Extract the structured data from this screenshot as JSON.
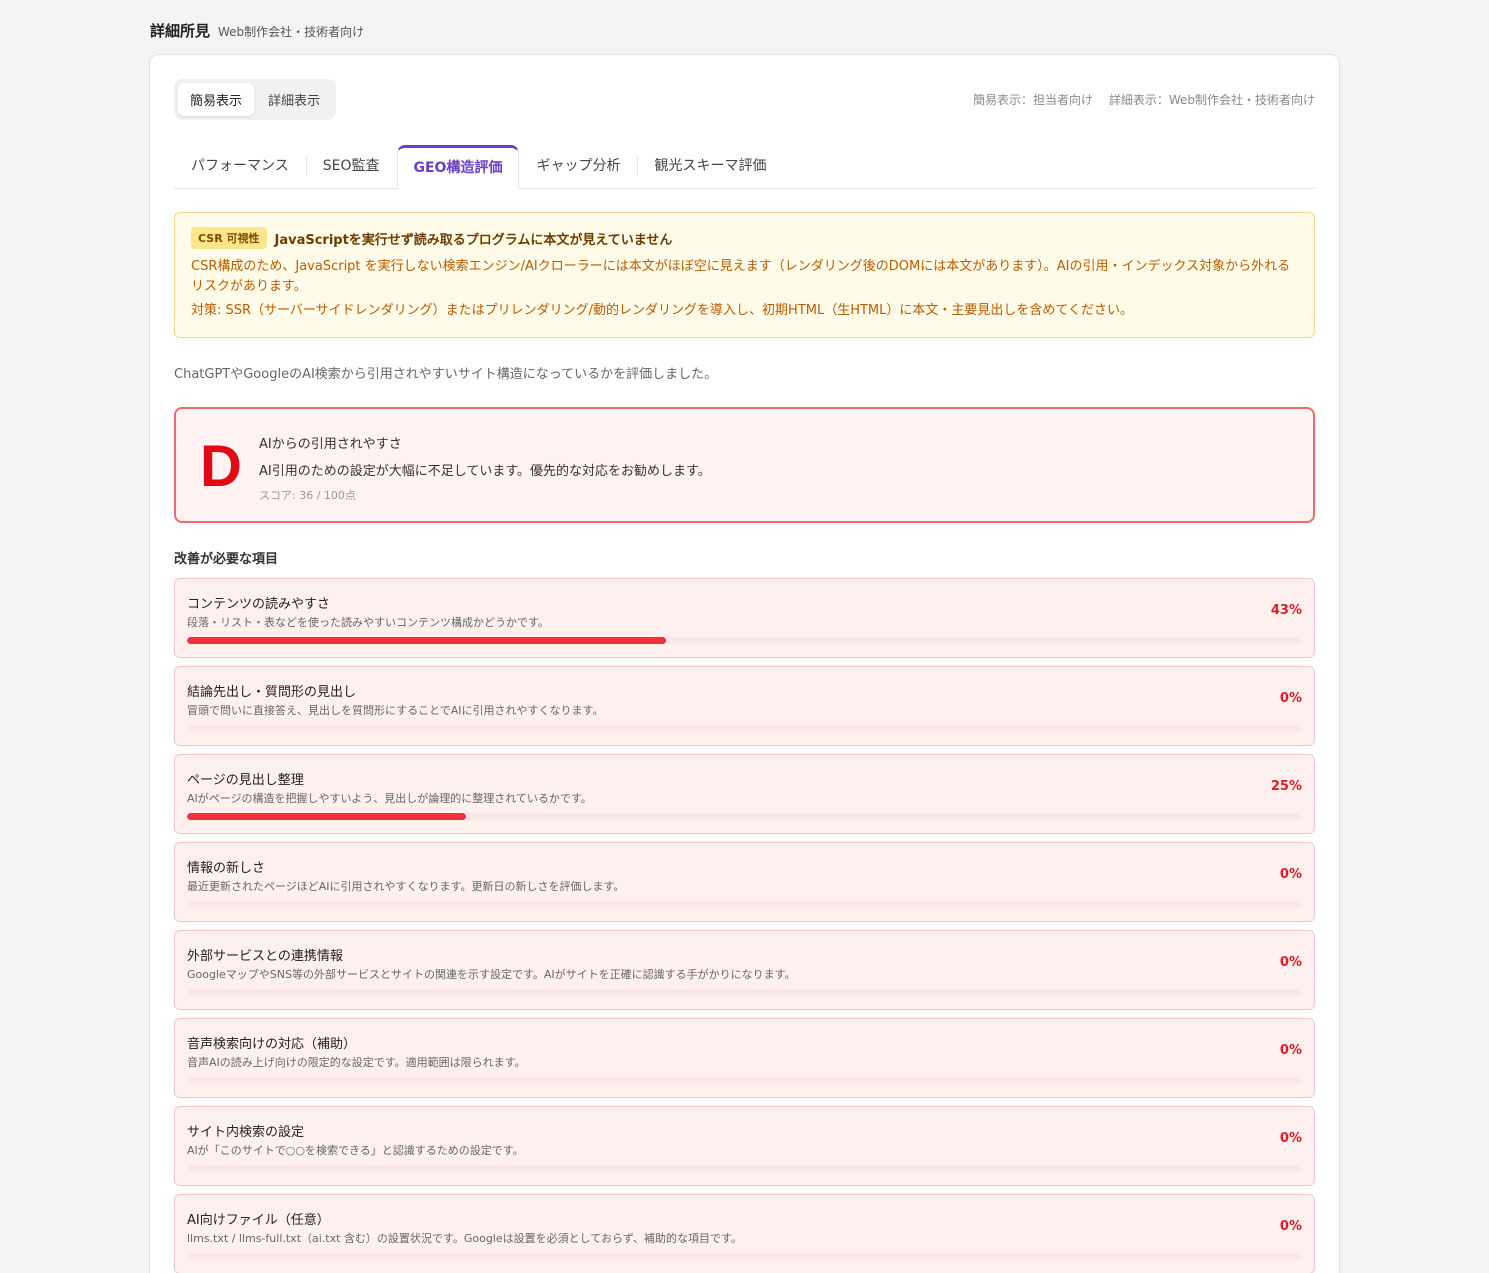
{
  "header": {
    "title": "詳細所見",
    "subtitle": "Web制作会社・技術者向け"
  },
  "view_toggle": {
    "simple_label": "簡易表示",
    "detail_label": "詳細表示",
    "active": "simple"
  },
  "view_note": {
    "simple": "簡易表示：担当者向け",
    "detail": "詳細表示：Web制作会社・技術者向け"
  },
  "tabs": [
    {
      "label": "パフォーマンス"
    },
    {
      "label": "SEO監査"
    },
    {
      "label": "GEO構造評価",
      "active": true
    },
    {
      "label": "ギャップ分析"
    },
    {
      "label": "観光スキーマ評価"
    }
  ],
  "csr": {
    "badge": "CSR 可視性",
    "title": "JavaScriptを実行せず読み取るプログラムに本文が見えていません",
    "text": "CSR構成のため、JavaScript を実行しない検索エンジン/AIクローラーには本文がほぼ空に見えます（レンダリング後のDOMには本文があります）。AIの引用・インデックス対象から外れるリスクがあります。",
    "action": "対策: SSR（サーバーサイドレンダリング）またはプリレンダリング/動的レンダリングを導入し、初期HTML（生HTML）に本文・主要見出しを含めてください。"
  },
  "intro": "ChatGPTやGoogleのAI検索から引用されやすいサイト構造になっているかを評価しました。",
  "grade": {
    "letter": "D",
    "title": "AIからの引用されやすさ",
    "description": "AI引用のための設定が大幅に不足しています。優先的な対応をお勧めします。",
    "score_text": "スコア: 36 / 100点",
    "color": "#e10a14"
  },
  "section_title": "改善が必要な項目",
  "items": [
    {
      "title": "コンテンツの読みやすさ",
      "description": "段落・リスト・表などを使った読みやすいコンテンツ構成かどうかです。",
      "percent_label": "43%",
      "percent": 43
    },
    {
      "title": "結論先出し・質問形の見出し",
      "description": "冒頭で問いに直接答え、見出しを質問形にすることでAIに引用されやすくなります。",
      "percent_label": "0%",
      "percent": 0
    },
    {
      "title": "ページの見出し整理",
      "description": "AIがページの構造を把握しやすいよう、見出しが論理的に整理されているかです。",
      "percent_label": "25%",
      "percent": 25
    },
    {
      "title": "情報の新しさ",
      "description": "最近更新されたページほどAIに引用されやすくなります。更新日の新しさを評価します。",
      "percent_label": "0%",
      "percent": 0
    },
    {
      "title": "外部サービスとの連携情報",
      "description": "GoogleマップやSNS等の外部サービスとサイトの関連を示す設定です。AIがサイトを正確に認識する手がかりになります。",
      "percent_label": "0%",
      "percent": 0
    },
    {
      "title": "音声検索向けの対応（補助）",
      "description": "音声AIの読み上げ向けの限定的な設定です。適用範囲は限られます。",
      "percent_label": "0%",
      "percent": 0
    },
    {
      "title": "サイト内検索の設定",
      "description": "AIが「このサイトで○○を検索できる」と認識するための設定です。",
      "percent_label": "0%",
      "percent": 0
    },
    {
      "title": "AI向けファイル（任意）",
      "description": "llms.txt / llms-full.txt（ai.txt 含む）の設置状況です。Googleは設置を必須としておらず、補助的な項目です。",
      "percent_label": "0%",
      "percent": 0
    }
  ]
}
